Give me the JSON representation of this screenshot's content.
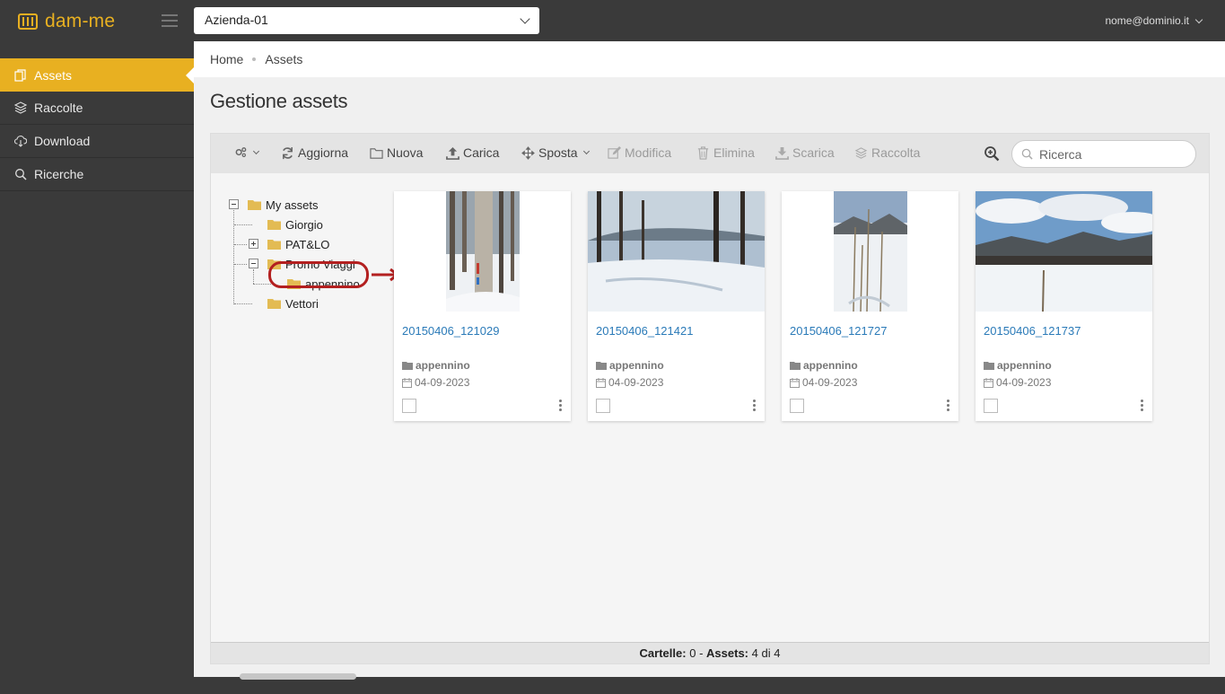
{
  "app": {
    "name": "dam-me",
    "brand_color": "#e8b021"
  },
  "header": {
    "company_select": "Azienda-01",
    "user": "nome@dominio.it"
  },
  "sidebar": {
    "items": [
      {
        "label": "Assets",
        "icon": "copy-icon",
        "active": true
      },
      {
        "label": "Raccolte",
        "icon": "layers-icon",
        "active": false
      },
      {
        "label": "Download",
        "icon": "cloud-download-icon",
        "active": false
      },
      {
        "label": "Ricerche",
        "icon": "search-icon",
        "active": false
      }
    ]
  },
  "breadcrumb": [
    "Home",
    "Assets"
  ],
  "page_title": "Gestione assets",
  "toolbar": {
    "refresh": "Aggiorna",
    "new": "Nuova",
    "upload": "Carica",
    "move": "Sposta",
    "edit": "Modifica",
    "delete": "Elimina",
    "download": "Scarica",
    "collection": "Raccolta",
    "search_placeholder": "Ricerca"
  },
  "tree": {
    "root": "My assets",
    "children": [
      "Giorgio",
      "PAT&LO",
      "Promo Viaggi",
      "Vettori"
    ],
    "promo_child": "appennino"
  },
  "assets": [
    {
      "name": "20150406_121029",
      "folder": "appennino",
      "date": "04-09-2023"
    },
    {
      "name": "20150406_121421",
      "folder": "appennino",
      "date": "04-09-2023"
    },
    {
      "name": "20150406_121727",
      "folder": "appennino",
      "date": "04-09-2023"
    },
    {
      "name": "20150406_121737",
      "folder": "appennino",
      "date": "04-09-2023"
    }
  ],
  "status": {
    "folders_label": "Cartelle:",
    "folders_value": "0",
    "sep": "-",
    "assets_label": "Assets:",
    "assets_value": "4 di 4"
  }
}
